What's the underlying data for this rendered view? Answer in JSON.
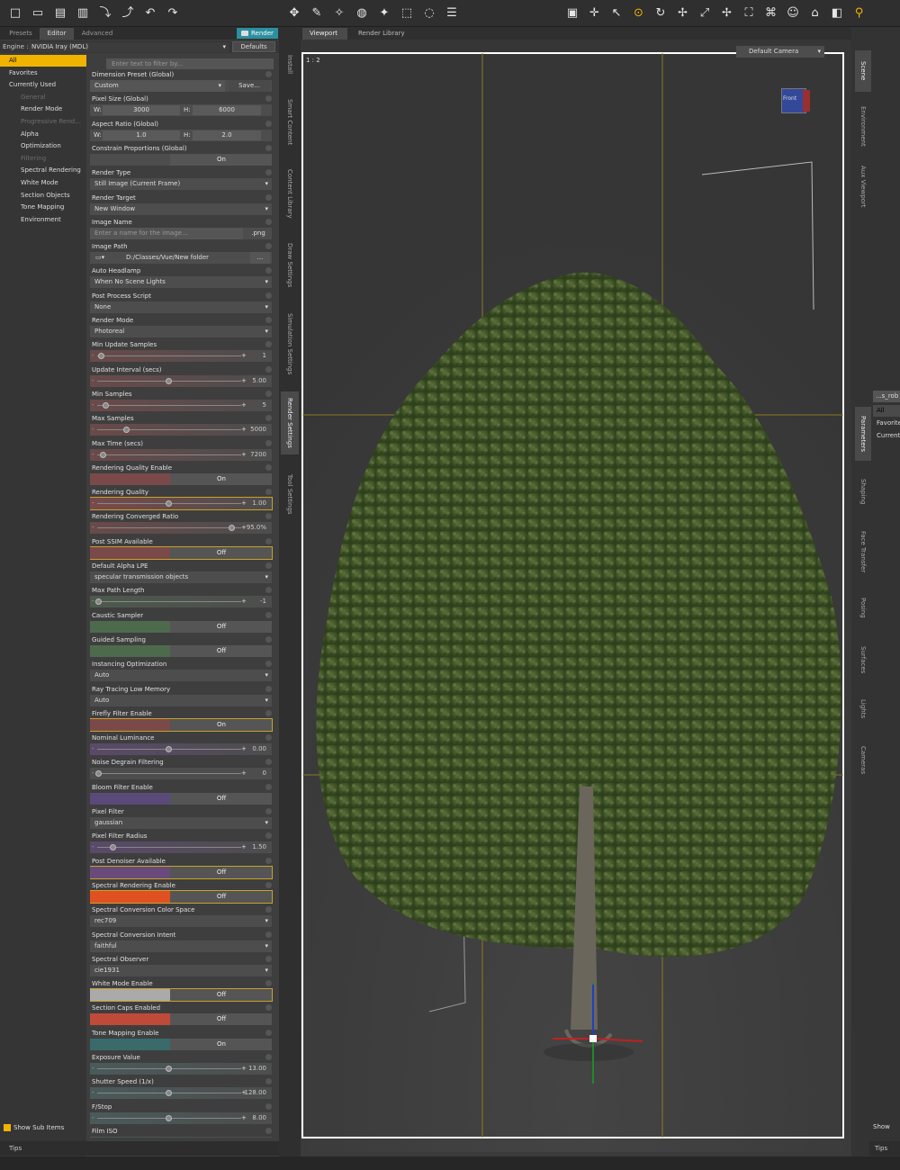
{
  "toolbar": {
    "left_icons": [
      "new-file-icon",
      "open-folder-icon",
      "open-icon",
      "save-icon",
      "import-icon",
      "export-icon",
      "undo-icon",
      "redo-icon"
    ],
    "right_icons": [
      "node-select-icon",
      "universal-tool-icon",
      "joint-editor-icon",
      "node-weight-icon",
      "region-nav-icon",
      "surface-selection-icon",
      "geometry-editor-icon",
      "menu-icon",
      "cameras-icon",
      "target-icon",
      "pointer-icon",
      "active-pose-icon",
      "rotate-icon",
      "translate-icon",
      "scale-icon",
      "transform-icon",
      "spot-render-icon",
      "shaping-icon",
      "face-icon",
      "perspective-icon",
      "render-icon",
      "lock-icon"
    ]
  },
  "left_panel": {
    "tabs": [
      "Presets",
      "Editor",
      "Advanced"
    ],
    "active_tab": "Editor",
    "render_button": "Render",
    "engine_label": "Engine :",
    "engine_value": "NVIDIA Iray (MDL)",
    "defaults_button": "Defaults",
    "filter_placeholder": "Enter text to filter by...",
    "sections": [
      {
        "label": "All",
        "active": true
      },
      {
        "label": "Favorites"
      },
      {
        "label": "Currently Used"
      },
      {
        "label": "General",
        "dim": true,
        "sub": true
      },
      {
        "label": "Render Mode",
        "sub": true
      },
      {
        "label": "Progressive Rend...",
        "dim": true,
        "sub": true
      },
      {
        "label": "Alpha",
        "sub": true
      },
      {
        "label": "Optimization",
        "sub": true
      },
      {
        "label": "Filtering",
        "dim": true,
        "sub": true
      },
      {
        "label": "Spectral Rendering",
        "sub": true
      },
      {
        "label": "White Mode",
        "sub": true
      },
      {
        "label": "Section Objects",
        "sub": true
      },
      {
        "label": "Tone Mapping",
        "sub": true
      },
      {
        "label": "Environment",
        "sub": true
      }
    ],
    "show_sub_items": "Show Sub Items",
    "tips": "Tips"
  },
  "properties": [
    {
      "label": "Dimension Preset (Global)",
      "type": "preset",
      "value": "Custom",
      "button": "Save..."
    },
    {
      "label": "Pixel Size (Global)",
      "type": "pair",
      "a": "W:",
      "av": "3000",
      "b": "H:",
      "bv": "6000"
    },
    {
      "label": "Aspect Ratio (Global)",
      "type": "pair",
      "a": "W:",
      "av": "1.0",
      "b": "H:",
      "bv": "2.0"
    },
    {
      "label": "Constrain Proportions (Global)",
      "type": "toggle",
      "value": "On",
      "color": "#4d4d4d"
    },
    {
      "label": "Render Type",
      "type": "dd",
      "value": "Still Image (Current Frame)"
    },
    {
      "label": "Render Target",
      "type": "dd",
      "value": "New Window"
    },
    {
      "label": "Image Name",
      "type": "text",
      "placeholder": "Enter a name for the image...",
      "ext": ".png"
    },
    {
      "label": "Image Path",
      "type": "path",
      "value": "D:/Classes/Vue/New folder"
    },
    {
      "label": "Auto Headlamp",
      "type": "dd",
      "value": "When No Scene Lights"
    },
    {
      "label": "Post Process Script",
      "type": "dd",
      "value": "None"
    },
    {
      "label": "Render Mode",
      "type": "dd",
      "value": "Photoreal"
    },
    {
      "label": "Min Update Samples",
      "type": "slider",
      "value": "1",
      "pos": 0.02,
      "color": "#6a4a4a"
    },
    {
      "label": "Update Interval (secs)",
      "type": "slider",
      "value": "5.00",
      "pos": 0.5,
      "color": "#6a4a4a"
    },
    {
      "label": "Min Samples",
      "type": "slider",
      "value": "5",
      "pos": 0.05,
      "color": "#6a4a4a"
    },
    {
      "label": "Max Samples",
      "type": "slider",
      "value": "5000",
      "pos": 0.2,
      "color": "#6a4a4a"
    },
    {
      "label": "Max Time (secs)",
      "type": "slider",
      "value": "7200",
      "pos": 0.03,
      "color": "#6a4a4a"
    },
    {
      "label": "Rendering Quality Enable",
      "type": "toggle",
      "value": "On",
      "color": "#7a4a4a"
    },
    {
      "label": "Rendering Quality",
      "type": "slider",
      "value": "1.00",
      "pos": 0.5,
      "color": "#7a4a4a",
      "hilite": true
    },
    {
      "label": "Rendering Converged Ratio",
      "type": "slider",
      "value": "95.0%",
      "pos": 0.95,
      "color": "#6a4a4a"
    },
    {
      "label": "Post SSIM Available",
      "type": "toggle",
      "value": "Off",
      "color": "#7a4a4a",
      "hilite": true
    },
    {
      "label": "Default Alpha LPE",
      "type": "dd",
      "value": "specular transmission objects"
    },
    {
      "label": "Max Path Length",
      "type": "slider",
      "value": "-1",
      "pos": 0.0,
      "color": "#4d5a4d"
    },
    {
      "label": "Caustic Sampler",
      "type": "toggle",
      "value": "Off",
      "color": "#4d6a4d"
    },
    {
      "label": "Guided Sampling",
      "type": "toggle",
      "value": "Off",
      "color": "#4d6a4d"
    },
    {
      "label": "Instancing Optimization",
      "type": "dd",
      "value": "Auto"
    },
    {
      "label": "Ray Tracing Low Memory",
      "type": "dd",
      "value": "Auto"
    },
    {
      "label": "Firefly Filter Enable",
      "type": "toggle",
      "value": "On",
      "color": "#7a4a4a",
      "hilite": true
    },
    {
      "label": "Nominal Luminance",
      "type": "slider",
      "value": "0.00",
      "pos": 0.5,
      "color": "#5a4a6a"
    },
    {
      "label": "Noise Degrain Filtering",
      "type": "slider",
      "value": "0",
      "pos": 0.0,
      "color": "#4d4d4d"
    },
    {
      "label": "Bloom Filter Enable",
      "type": "toggle",
      "value": "Off",
      "color": "#5a4a7a"
    },
    {
      "label": "Pixel Filter",
      "type": "dd",
      "value": "gaussian"
    },
    {
      "label": "Pixel Filter Radius",
      "type": "slider",
      "value": "1.50",
      "pos": 0.1,
      "color": "#5a4a6a"
    },
    {
      "label": "Post Denoiser Available",
      "type": "toggle",
      "value": "Off",
      "color": "#6a4a7a",
      "hilite": true
    },
    {
      "label": "Spectral Rendering Enable",
      "type": "toggle",
      "value": "Off",
      "color": "#e05020",
      "hilite": true
    },
    {
      "label": "Spectral Conversion Color Space",
      "type": "dd",
      "value": "rec709"
    },
    {
      "label": "Spectral Conversion Intent",
      "type": "dd",
      "value": "faithful"
    },
    {
      "label": "Spectral Observer",
      "type": "dd",
      "value": "cie1931"
    },
    {
      "label": "White Mode Enable",
      "type": "toggle",
      "value": "Off",
      "color": "#aaaaaa",
      "hilite": true
    },
    {
      "label": "Section Caps Enabled",
      "type": "toggle",
      "value": "Off",
      "color": "#c04a3a"
    },
    {
      "label": "Tone Mapping Enable",
      "type": "toggle",
      "value": "On",
      "color": "#3a6a6a"
    },
    {
      "label": "Exposure Value",
      "type": "slider",
      "value": "13.00",
      "pos": 0.5,
      "color": "#4a5a5a"
    },
    {
      "label": "Shutter Speed (1/x)",
      "type": "slider",
      "value": "128.00",
      "pos": 0.5,
      "color": "#4a5a5a"
    },
    {
      "label": "F/Stop",
      "type": "slider",
      "value": "8.00",
      "pos": 0.5,
      "color": "#4a5a5a"
    },
    {
      "label": "Film ISO",
      "type": "slider",
      "value": "",
      "pos": 0.5,
      "color": "#4a5a5a"
    }
  ],
  "side_tabs": [
    "Install",
    "Smart Content",
    "Content Library",
    "Draw Settings",
    "Simulation Settings",
    "Render Settings",
    "Tool Settings"
  ],
  "active_side_tab": "Render Settings",
  "viewport": {
    "tabs": [
      "Viewport",
      "Render Library"
    ],
    "camera": "Default Camera",
    "ratio": "1 : 2",
    "cube_label": "Front"
  },
  "right_panel": {
    "top_tabs": [
      "Scene",
      "Environment",
      "Aux Viewport"
    ],
    "bottom_tabs": [
      "Parameters",
      "Shaping",
      "Face Transfer",
      "Posing",
      "Surfaces",
      "Lights",
      "Cameras"
    ],
    "search_value": "...s_rob",
    "list": [
      "All",
      "Favorite",
      "Current"
    ],
    "show": "Show",
    "tips": "Tips"
  },
  "colors": {
    "accent": "#f0b400",
    "render": "#2c8fa0"
  }
}
